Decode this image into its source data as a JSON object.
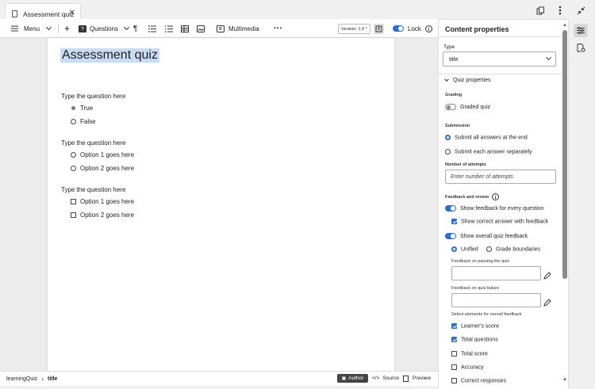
{
  "tab": {
    "title": "Assessment quiz",
    "close": "✕"
  },
  "toolbar": {
    "menu": "Menu",
    "questions": "Questions",
    "multimedia": "Multimedia",
    "version": "Version: 1.0 *",
    "lock": "Lock"
  },
  "document": {
    "title": "Assessment quiz",
    "questions": [
      {
        "text": "Type the question here",
        "type": "radio",
        "options": [
          "True",
          "False"
        ],
        "selected": 0
      },
      {
        "text": "Type the question here",
        "type": "radio",
        "options": [
          "Option 1 goes here",
          "Option 2 goes here"
        ]
      },
      {
        "text": "Type the question here",
        "type": "checkbox",
        "options": [
          "Option 1 goes here",
          "Option 2 goes here"
        ]
      }
    ]
  },
  "status": {
    "path": [
      "learningQuiz",
      "title"
    ],
    "author": "Author",
    "source": "Source",
    "preview": "Preview"
  },
  "panel": {
    "title": "Content properties",
    "type_label": "Type",
    "type_value": "title",
    "section": "Quiz properties",
    "grading_label": "Grading",
    "graded_quiz": "Graded quiz",
    "submission_label": "Submission",
    "submit_end": "Submit all answers at the end",
    "submit_each": "Submit each answer separately",
    "attempts_label": "Number of attempts",
    "attempts_placeholder": "Enter number of attempts",
    "feedback_label": "Feedback and review",
    "show_feedback_every": "Show feedback for every question",
    "show_correct": "Show correct answer with feedback",
    "show_overall": "Show overall quiz feedback",
    "unified": "Unified",
    "grade_boundaries": "Grade boundaries",
    "feedback_pass_label": "Feedback on passing the quiz",
    "feedback_fail_label": "Feedback on quiz failure",
    "select_elements_label": "Select elements for overall feedback",
    "elements": [
      {
        "label": "Learner's score",
        "checked": true
      },
      {
        "label": "Total questions",
        "checked": true
      },
      {
        "label": "Total score",
        "checked": false
      },
      {
        "label": "Accuracy",
        "checked": false
      },
      {
        "label": "Correct responses",
        "checked": false
      }
    ]
  },
  "colors": {
    "accent": "#2a6ed9",
    "selection": "#c8dcf6"
  }
}
